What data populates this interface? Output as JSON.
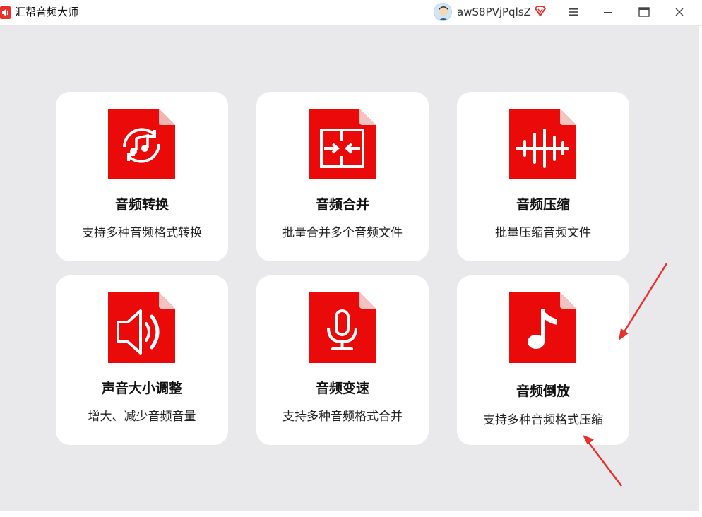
{
  "window": {
    "title": "汇帮音频大师",
    "username": "awS8PVjPqlsZ",
    "accent": "#e8312c"
  },
  "cards": [
    {
      "title": "音频转换",
      "desc": "支持多种音频格式转换",
      "icon": "audio-convert-icon"
    },
    {
      "title": "音频合并",
      "desc": "批量合并多个音频文件",
      "icon": "audio-merge-icon"
    },
    {
      "title": "音频压缩",
      "desc": "批量压缩音频文件",
      "icon": "audio-compress-icon"
    },
    {
      "title": "声音大小调整",
      "desc": "增大、减少音频音量",
      "icon": "volume-adjust-icon"
    },
    {
      "title": "音频变速",
      "desc": "支持多种音频格式合并",
      "icon": "microphone-icon"
    },
    {
      "title": "音频倒放",
      "desc": "支持多种音频格式压缩",
      "icon": "music-note-icon"
    }
  ]
}
